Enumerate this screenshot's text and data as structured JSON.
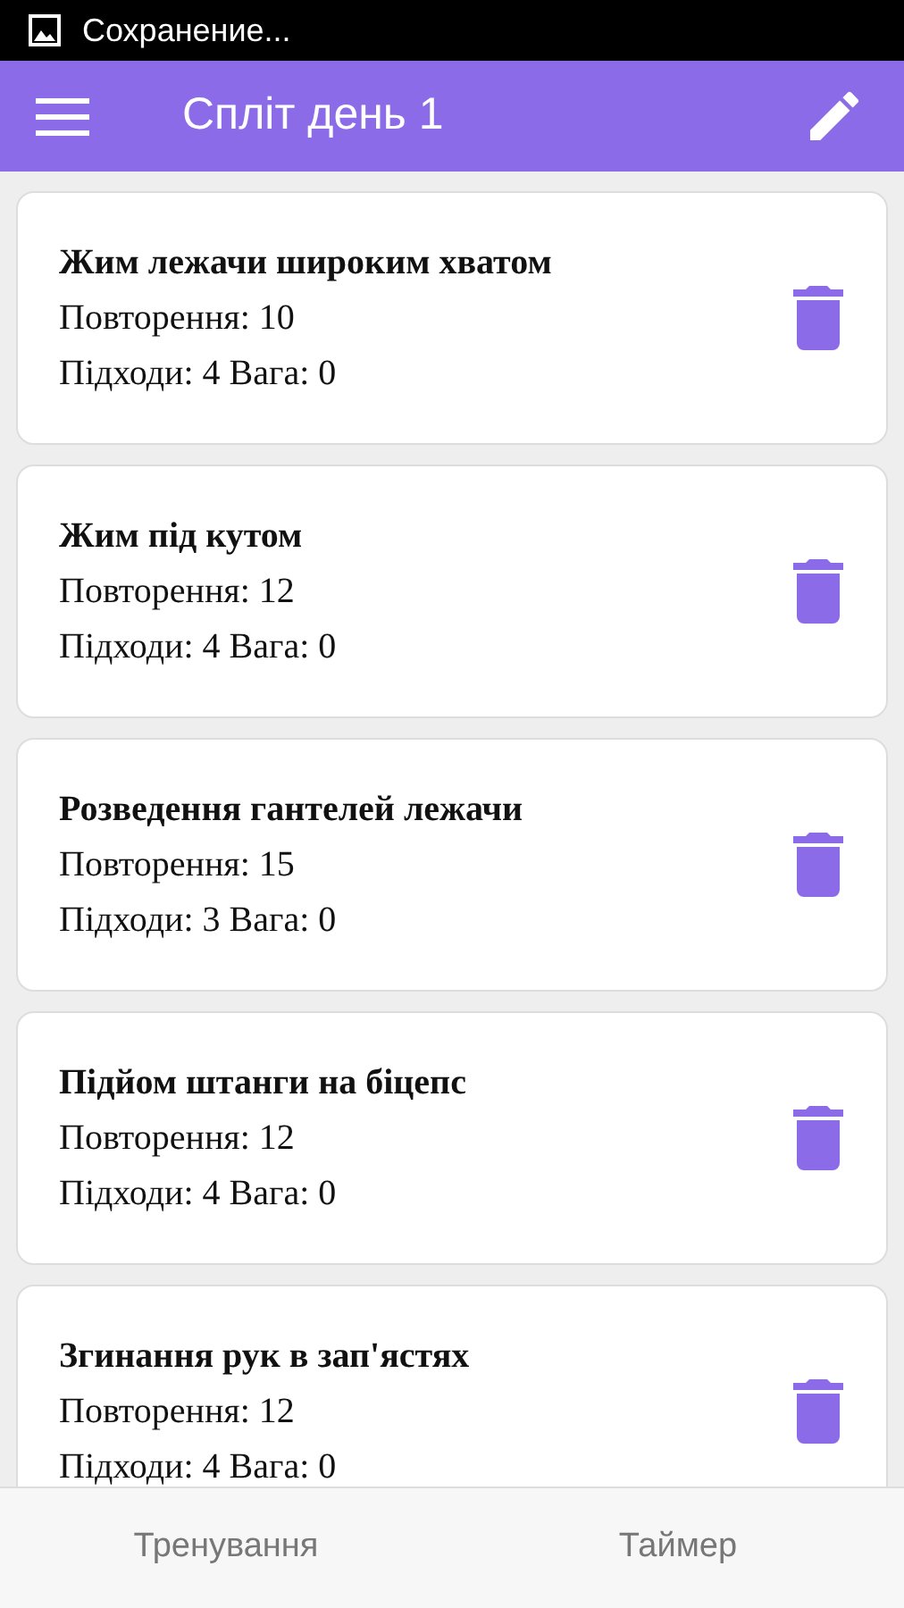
{
  "status_bar": {
    "text": "Сохранение..."
  },
  "app_bar": {
    "title": "Спліт день 1"
  },
  "exercises": [
    {
      "name": "Жим лежачи широким хватом",
      "reps": "Повторення: 10",
      "sets_weight": "Підходи: 4 Вага: 0"
    },
    {
      "name": "Жим під кутом",
      "reps": "Повторення: 12",
      "sets_weight": "Підходи: 4 Вага: 0"
    },
    {
      "name": "Розведення гантелей лежачи",
      "reps": "Повторення: 15",
      "sets_weight": "Підходи: 3 Вага: 0"
    },
    {
      "name": "Підйом штанги на біцепс",
      "reps": "Повторення: 12",
      "sets_weight": "Підходи: 4 Вага: 0"
    },
    {
      "name": "Згинання рук в зап'ястях",
      "reps": "Повторення: 12",
      "sets_weight": "Підходи: 4 Вага: 0"
    }
  ],
  "bottom_nav": [
    {
      "label": "Тренування"
    },
    {
      "label": "Таймер"
    }
  ]
}
